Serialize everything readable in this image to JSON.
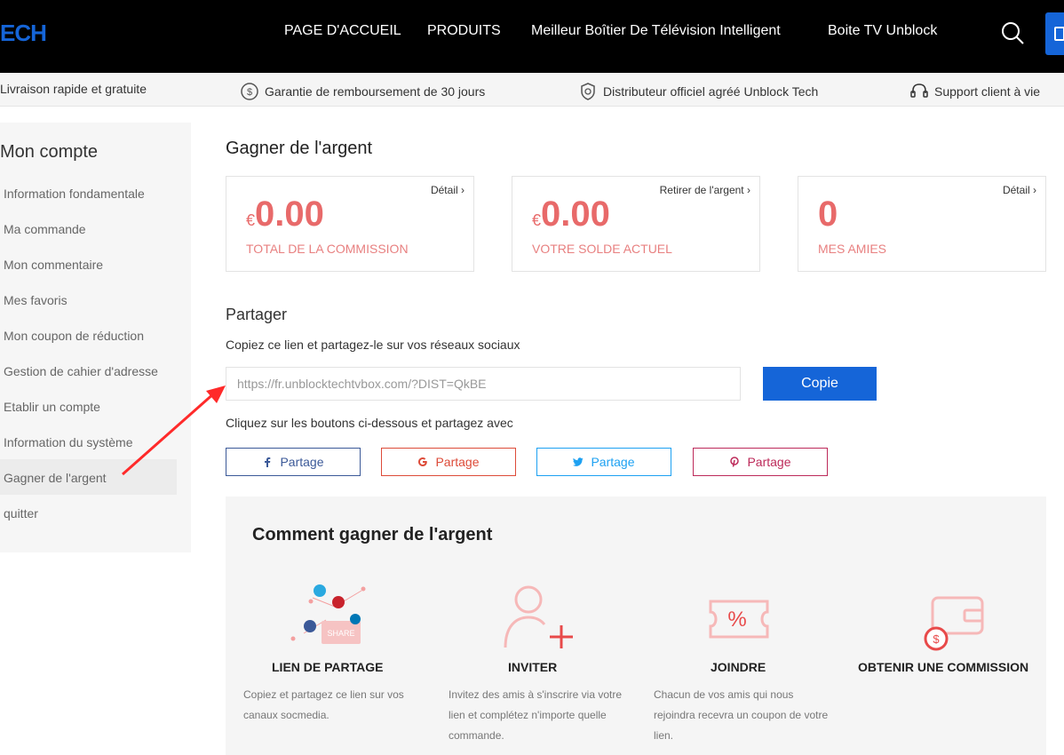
{
  "header": {
    "logo": "ECH",
    "nav": [
      "PAGE D'ACCUEIL",
      "PRODUITS",
      "Meilleur Boîtier De Télévision Intelligent",
      "Boite TV Unblock"
    ]
  },
  "trustbar": {
    "items": [
      "Livraison rapide et gratuite",
      "Garantie de remboursement de 30 jours",
      "Distributeur officiel agréé Unblock Tech",
      "Support client à vie"
    ]
  },
  "sidebar": {
    "title": "Mon compte",
    "items": [
      "Information fondamentale",
      "Ma commande",
      "Mon commentaire",
      "Mes favoris",
      "Mon coupon de réduction",
      "Gestion de cahier d'adresse",
      "Etablir un compte",
      "Information du système",
      "Gagner de l'argent",
      "quitter"
    ]
  },
  "main": {
    "title": "Gagner de l'argent",
    "cards": [
      {
        "link": "Détail",
        "currency": "€",
        "amount": "0.00",
        "label": "TOTAL DE LA COMMISSION"
      },
      {
        "link": "Retirer de l'argent",
        "currency": "€",
        "amount": "0.00",
        "label": "VOTRE SOLDE ACTUEL"
      },
      {
        "link": "Détail",
        "currency": "",
        "amount": "0",
        "label": "MES AMIES"
      }
    ],
    "share": {
      "title": "Partager",
      "desc": "Copiez ce lien et partagez-le sur vos réseaux sociaux",
      "url": "https://fr.unblocktechtvbox.com/?DIST=QkBE",
      "copy_label": "Copie",
      "hint": "Cliquez sur les boutons ci-dessous et partagez avec",
      "buttons": [
        {
          "label": "Partage",
          "color": "#3b5998"
        },
        {
          "label": "Partage",
          "color": "#dd4b39"
        },
        {
          "label": "Partage",
          "color": "#1da1f2"
        },
        {
          "label": "Partage",
          "color": "#bd2a5a"
        }
      ]
    },
    "how": {
      "title": "Comment gagner de l'argent",
      "share_badge": "SHARE",
      "steps": [
        {
          "title": "LIEN DE PARTAGE",
          "desc": "Copiez et partagez ce lien sur vos canaux socmedia."
        },
        {
          "title": "INVITER",
          "desc": "Invitez des amis à s'inscrire via votre lien et complétez n'importe quelle commande."
        },
        {
          "title": "JOINDRE",
          "desc": "Chacun de vos amis qui nous rejoindra recevra un coupon de votre lien."
        },
        {
          "title": "OBTENIR UNE COMMISSION",
          "desc": ""
        }
      ]
    }
  },
  "colors": {
    "accent": "#1565d8",
    "amount": "#e86a6a",
    "icon": "#f08a8a"
  }
}
